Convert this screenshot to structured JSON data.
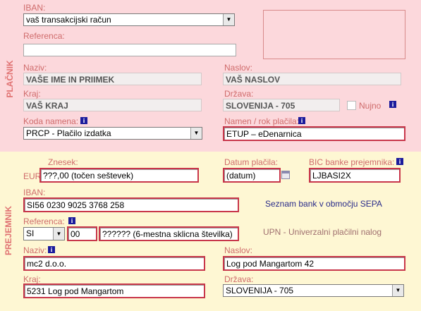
{
  "platnik": {
    "section_label": "PLAČNIK",
    "iban_label": "IBAN:",
    "iban_value": "vaš transakcijski račun",
    "referenca_label": "Referenca:",
    "referenca_value": "",
    "naziv_label": "Naziv:",
    "naziv_value": "VAŠE IME IN PRIIMEK",
    "naslov_label": "Naslov:",
    "naslov_value": "VAŠ NASLOV",
    "kraj_label": "Kraj:",
    "kraj_value": "VAŠ KRAJ",
    "drzava_label": "Država:",
    "drzava_value": "SLOVENIJA - 705",
    "nujno_label": "Nujno",
    "koda_label": "Koda namena:",
    "koda_value": "PRCP - Plačilo izdatka",
    "namen_label": "Namen / rok plačila:",
    "namen_value": "ETUP – eDenarnica"
  },
  "prejemnik": {
    "section_label": "PREJEMNIK",
    "currency": "EUR",
    "znesek_label": "Znesek:",
    "znesek_value": "???,00 (točen seštevek)",
    "datum_label": "Datum plačila:",
    "datum_value": "(datum)",
    "bic_label": "BIC banke prejemnika:",
    "bic_value": "LJBASI2X",
    "iban_label": "IBAN:",
    "iban_value": "SI56 0230 9025 3768 258",
    "seznam_link": "Seznam bank v območju SEPA",
    "referenca_label": "Referenca:",
    "ref_model": "SI",
    "ref_num": "00",
    "ref_value": "?????? (6-mestna sklicna številka)",
    "upn_link": "UPN - Univerzalni plačilni nalog",
    "naziv_label": "Naziv:",
    "naziv_value": "mc2 d.o.o.",
    "naslov_label": "Naslov:",
    "naslov_value": "Log pod Mangartom 42",
    "kraj_label": "Kraj:",
    "kraj_value": "5231 Log pod Mangartom",
    "drzava_label": "Država:",
    "drzava_value": "SLOVENIJA - 705"
  },
  "icons": {
    "info": "i",
    "dropdown": "▼",
    "calendar": "calendar-icon"
  }
}
